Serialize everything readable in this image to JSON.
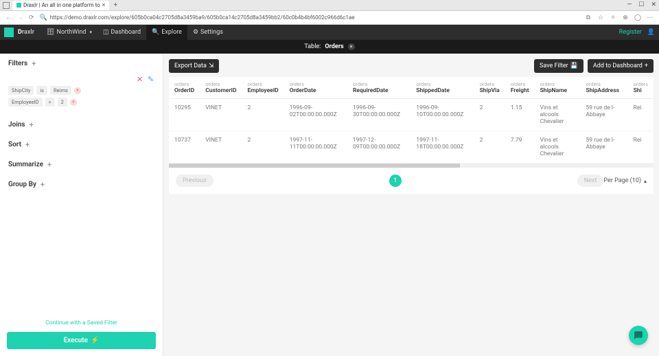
{
  "browser": {
    "tab_title": "Draxlr | An all in one platform to",
    "url": "https://demo.draxlr.com/explore/605b0ca04c2705d8a3459ba9/605b0ca14c2705d8a3459bb2/60c0b4b4bf6002c966d6c1ae"
  },
  "nav": {
    "brand": "Draxlr",
    "db": "NorthWind",
    "dashboard": "Dashboard",
    "explore": "Explore",
    "settings": "Settings",
    "register": "Register"
  },
  "table_bar": {
    "label": "Table:",
    "name": "Orders"
  },
  "sidebar": {
    "filters": "Filters",
    "joins": "Joins",
    "sort": "Sort",
    "summarize": "Summarize",
    "groupby": "Group By",
    "chip1": {
      "field": "ShipCity",
      "op": "is",
      "val": "Reims"
    },
    "chip2": {
      "field": "EmployeeID",
      "op": "=",
      "val": "2"
    },
    "saved_link": "Continue with a Saved Filter",
    "execute": "Execute"
  },
  "actions": {
    "export": "Export Data",
    "save_filter": "Save Filter",
    "add_dashboard": "Add to Dashboard"
  },
  "table": {
    "group": "orders",
    "cols": [
      "OrderID",
      "CustomerID",
      "EmployeeID",
      "OrderDate",
      "RequiredDate",
      "ShippedDate",
      "ShipVia",
      "Freight",
      "ShipName",
      "ShipAddress",
      "Shi"
    ],
    "rows": [
      {
        "OrderID": "10295",
        "CustomerID": "VINET",
        "EmployeeID": "2",
        "OrderDate": "1996-09-02T00:00:00.000Z",
        "RequiredDate": "1996-09-30T00:00:00.000Z",
        "ShippedDate": "1996-09-10T00:00:00.000Z",
        "ShipVia": "2",
        "Freight": "1.15",
        "ShipName": "Vins et alcools Chevalier",
        "ShipAddress": "59 rue de l-Abbaye",
        "Shi": "Rei"
      },
      {
        "OrderID": "10737",
        "CustomerID": "VINET",
        "EmployeeID": "2",
        "OrderDate": "1997-11-11T00:00:00.000Z",
        "RequiredDate": "1997-12-09T00:00:00.000Z",
        "ShippedDate": "1997-11-18T00:00:00.000Z",
        "ShipVia": "2",
        "Freight": "7.79",
        "ShipName": "Vins et alcools Chevalier",
        "ShipAddress": "59 rue de l-Abbaye",
        "Shi": "Rei"
      }
    ]
  },
  "pagination": {
    "prev": "Previous",
    "page": "1",
    "next": "Next",
    "per_page": "Per Page (10)"
  }
}
